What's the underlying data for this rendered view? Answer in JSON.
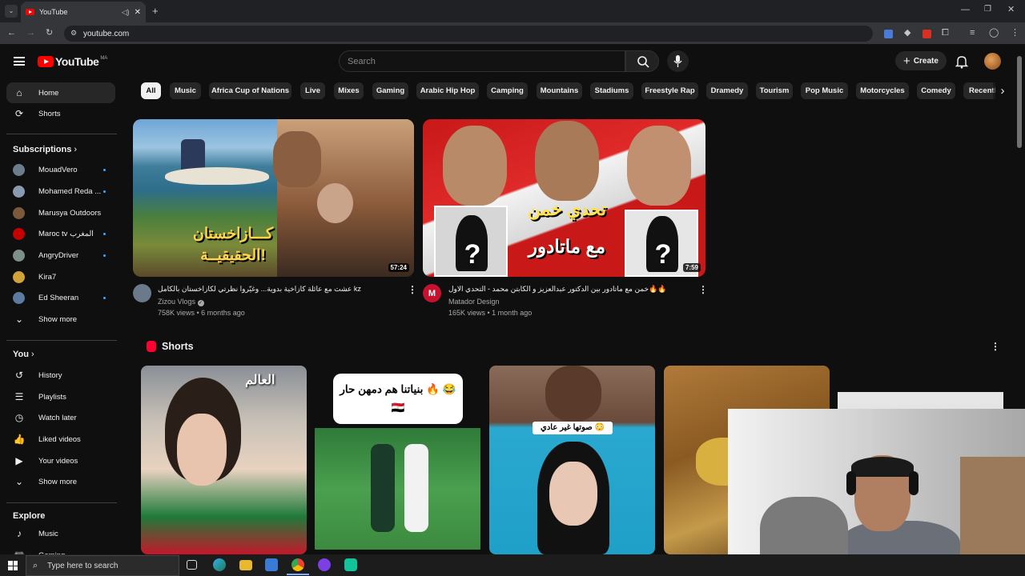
{
  "browser": {
    "tab_title": "YouTube",
    "url": "youtube.com"
  },
  "header": {
    "logo_text": "YouTube",
    "logo_region": "MA",
    "search_placeholder": "Search",
    "create_label": "Create"
  },
  "sidebar": {
    "main": [
      {
        "label": "Home",
        "icon": "home-icon"
      },
      {
        "label": "Shorts",
        "icon": "shorts-icon"
      }
    ],
    "subscriptions_title": "Subscriptions",
    "subscriptions": [
      {
        "label": "MouadVero",
        "color": "#6b7d8c"
      },
      {
        "label": "Mohamed Reda ...",
        "color": "#8a9bb0"
      },
      {
        "label": "Marusya Outdoors",
        "color": "#7a5a3a"
      },
      {
        "label": "Maroc tv المغرب",
        "color": "#c40000"
      },
      {
        "label": "AngryDriver",
        "color": "#7d8f8a"
      },
      {
        "label": "Kira7",
        "color": "#d1a13a"
      },
      {
        "label": "Ed Sheeran",
        "color": "#5d7aa0"
      }
    ],
    "show_more_1": "Show more",
    "you_title": "You",
    "you_items": [
      {
        "label": "History",
        "icon": "history-icon"
      },
      {
        "label": "Playlists",
        "icon": "playlists-icon"
      },
      {
        "label": "Watch later",
        "icon": "watch-later-icon"
      },
      {
        "label": "Liked videos",
        "icon": "liked-icon"
      },
      {
        "label": "Your videos",
        "icon": "your-videos-icon"
      }
    ],
    "show_more_2": "Show more",
    "explore_title": "Explore",
    "explore_items": [
      {
        "label": "Music",
        "icon": "music-icon"
      },
      {
        "label": "Gaming",
        "icon": "gaming-icon"
      }
    ]
  },
  "chips": [
    "All",
    "Music",
    "Africa Cup of Nations",
    "Live",
    "Mixes",
    "Gaming",
    "Arabic Hip Hop",
    "Camping",
    "Mountains",
    "Stadiums",
    "Freestyle Rap",
    "Dramedy",
    "Tourism",
    "Pop Music",
    "Motorcycles",
    "Comedy",
    "Recentl"
  ],
  "videos": [
    {
      "title": "عشت مع عائلة كازاخية بدوية... وغيّروا نظرتي لكازاخستان بالكامل kz",
      "channel": "Zizou Vlogs",
      "meta": "758K views • 6 months ago",
      "duration": "57:24",
      "overlay_text": "كـــازاخستان الحقيقيــة!"
    },
    {
      "title": "خمن مع ماتادور بين الدكتور عبدالعزيز و الكابتن محمد - التحدي الاول🔥🔥",
      "channel": "Matador Design",
      "channel_initial": "M",
      "meta": "165K views • 1 month ago",
      "duration": "7:59",
      "overlay_text_1": "تحدي خمن",
      "overlay_text_2": "مع ماتادور",
      "mystery": "?"
    }
  ],
  "shorts": {
    "title": "Shorts",
    "items": [
      {
        "overlay": "العالم"
      },
      {
        "overlay": "بنياتنا هم دمهن حار 🔥 😂🇪🇬"
      },
      {
        "overlay": "صوتها غير عادي 😳"
      },
      {
        "overlay": ""
      },
      {
        "overlay": ""
      }
    ]
  },
  "taskbar": {
    "search_placeholder": "Type here to search"
  }
}
